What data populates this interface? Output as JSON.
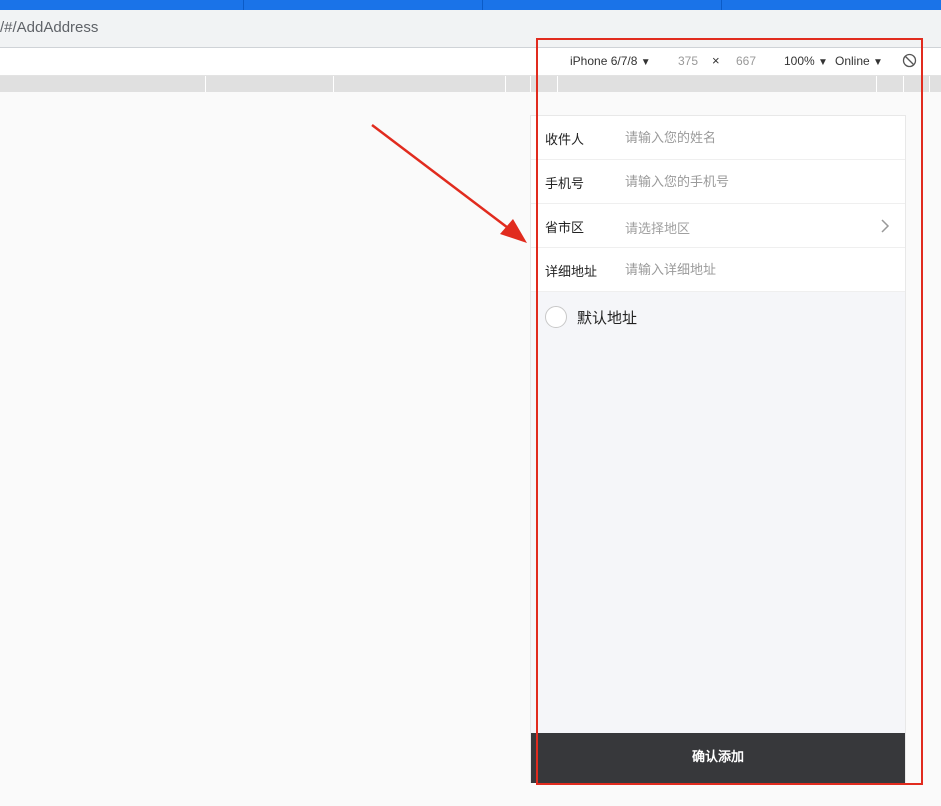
{
  "browser": {
    "url": "/#/AddAddress"
  },
  "devtools": {
    "device": "iPhone 6/7/8",
    "width": "375",
    "times": "×",
    "height": "667",
    "zoom": "100%",
    "network": "Online",
    "dropdown_glyph": "▼"
  },
  "form": {
    "fields": [
      {
        "label": "收件人",
        "placeholder": "请输入您的姓名"
      },
      {
        "label": "手机号",
        "placeholder": "请输入您的手机号"
      },
      {
        "label": "省市区",
        "placeholder": "请选择地区"
      },
      {
        "label": "详细地址",
        "placeholder": "请输入详细地址"
      }
    ],
    "default_label": "默认地址",
    "confirm_label": "确认添加"
  },
  "annotation": {
    "color": "#e12b1e"
  }
}
